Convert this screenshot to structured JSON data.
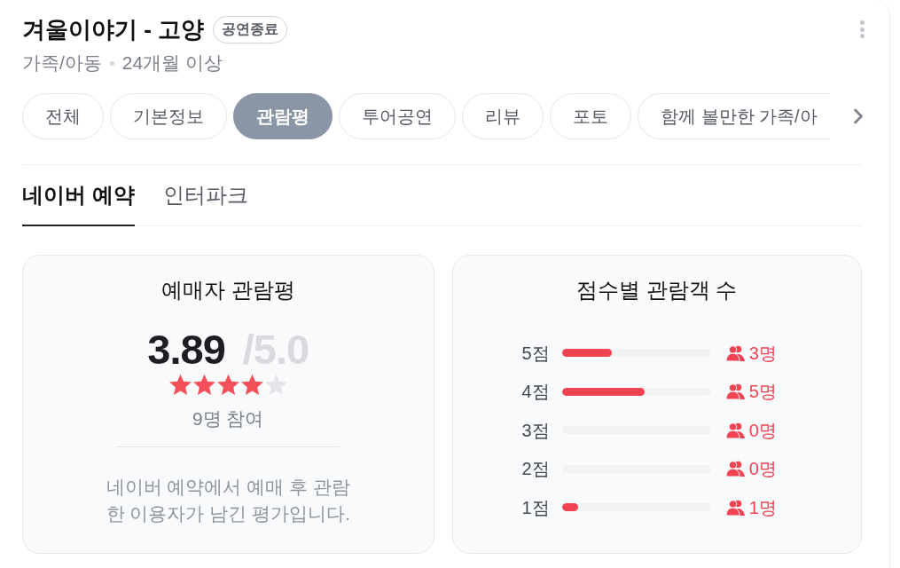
{
  "header": {
    "title": "겨울이야기 - 고양",
    "badge": "공연종료",
    "genre": "가족/아동",
    "age": "24개월 이상"
  },
  "tabs": [
    {
      "label": "전체",
      "selected": false
    },
    {
      "label": "기본정보",
      "selected": false
    },
    {
      "label": "관람평",
      "selected": true
    },
    {
      "label": "투어공연",
      "selected": false
    },
    {
      "label": "리뷰",
      "selected": false
    },
    {
      "label": "포토",
      "selected": false
    },
    {
      "label": "함께 볼만한 가족/아",
      "selected": false
    }
  ],
  "booking_tabs": [
    {
      "label": "네이버 예약",
      "selected": true
    },
    {
      "label": "인터파크",
      "selected": false
    }
  ],
  "rating_card": {
    "title": "예매자 관람평",
    "score": "3.89",
    "max": "/5.0",
    "stars": 4,
    "participants": "9명 참여",
    "note": "네이버 예약에서 예매 후 관람 한 이용자가 남긴 평가입니다."
  },
  "distribution_card": {
    "title": "점수별 관람객 수",
    "rows": [
      {
        "label": "5점",
        "level": 0.333,
        "count": "3명"
      },
      {
        "label": "4점",
        "level": 0.556,
        "count": "5명"
      },
      {
        "label": "3점",
        "level": 0,
        "count": "0명"
      },
      {
        "label": "2점",
        "level": 0,
        "count": "0명"
      },
      {
        "label": "1점",
        "level": 0.111,
        "count": "1명"
      }
    ]
  }
}
